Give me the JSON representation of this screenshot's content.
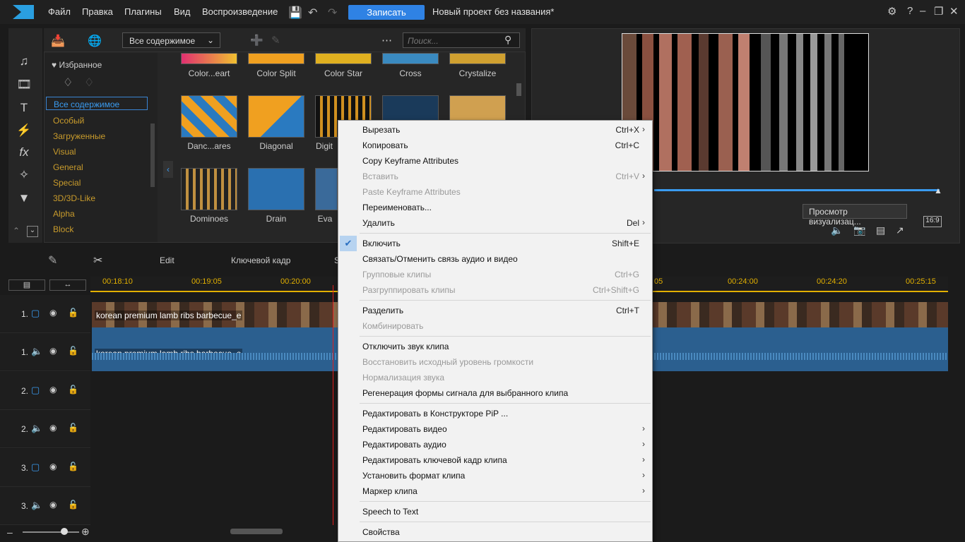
{
  "menubar": {
    "items": [
      "Файл",
      "Правка",
      "Плагины",
      "Вид",
      "Воспроизведение"
    ],
    "record": "Записать",
    "project_title": "Новый проект без названия*"
  },
  "library": {
    "dropdown": "Все содержимое",
    "search_placeholder": "Поиск...",
    "favorites": "Избранное",
    "all_content": "Все содержимое",
    "categories": [
      "Особый",
      "Загруженные",
      "Visual",
      "General",
      "Special",
      "3D/3D-Like",
      "Alpha",
      "Block"
    ],
    "thumbs_row1": [
      "Color...eart",
      "Color Split",
      "Color Star",
      "Cross",
      "Crystalize"
    ],
    "thumbs_row2": [
      "Danc...ares",
      "Diagonal",
      "Digit"
    ],
    "thumbs_row3": [
      "Dominoes",
      "Drain",
      "Eva"
    ]
  },
  "preview": {
    "render_button": "Просмотр визуализац...",
    "aspect": "16:9"
  },
  "timeline": {
    "tools": [
      "Edit",
      "Ключевой кадр",
      "S"
    ],
    "timecodes": [
      "00:18:10",
      "00:19:05",
      "00:20:00",
      "00:24:00",
      "00:24:20",
      "00:25:15",
      "05"
    ],
    "tracks": [
      "1.",
      "1.",
      "2.",
      "2.",
      "3.",
      "3."
    ],
    "clip_name": "korean premium lamb ribs barbecue_e"
  },
  "context_menu": [
    {
      "label": "Вырезать",
      "shortcut": "Ctrl+X",
      "arrow": true,
      "disabled": false
    },
    {
      "label": "Копировать",
      "shortcut": "Ctrl+C",
      "disabled": false
    },
    {
      "label": "Copy Keyframe Attributes",
      "disabled": false
    },
    {
      "label": "Вставить",
      "shortcut": "Ctrl+V",
      "arrow": true,
      "disabled": true
    },
    {
      "label": "Paste Keyframe Attributes",
      "disabled": true
    },
    {
      "label": "Переименовать...",
      "disabled": false
    },
    {
      "label": "Удалить",
      "shortcut": "Del",
      "arrow": true,
      "disabled": false
    },
    {
      "sep": true
    },
    {
      "label": "Включить",
      "shortcut": "Shift+E",
      "checked": true,
      "disabled": false
    },
    {
      "label": "Связать/Отменить связь аудио и видео",
      "disabled": false
    },
    {
      "label": "Групповые клипы",
      "shortcut": "Ctrl+G",
      "disabled": true
    },
    {
      "label": "Разгруппировать клипы",
      "shortcut": "Ctrl+Shift+G",
      "disabled": true
    },
    {
      "sep": true
    },
    {
      "label": "Разделить",
      "shortcut": "Ctrl+T",
      "disabled": false
    },
    {
      "label": "Комбинировать",
      "disabled": true
    },
    {
      "sep": true
    },
    {
      "label": "Отключить звук клипа",
      "disabled": false
    },
    {
      "label": "Восстановить исходный уровень громкости",
      "disabled": true
    },
    {
      "label": "Нормализация звука",
      "disabled": true
    },
    {
      "label": "Регенерация формы сигнала для выбранного клипа",
      "disabled": false
    },
    {
      "sep": true
    },
    {
      "label": "Редактировать в Конструкторе PiP ...",
      "disabled": false
    },
    {
      "label": "Редактировать видео",
      "arrow": true,
      "disabled": false
    },
    {
      "label": "Редактировать аудио",
      "arrow": true,
      "disabled": false
    },
    {
      "label": "Редактировать ключевой кадр клипа",
      "arrow": true,
      "disabled": false
    },
    {
      "label": "Установить формат клипа",
      "arrow": true,
      "disabled": false
    },
    {
      "label": "Маркер клипа",
      "arrow": true,
      "disabled": false
    },
    {
      "sep": true
    },
    {
      "label": "Speech to Text",
      "disabled": false
    },
    {
      "sep": true
    },
    {
      "label": "Свойства",
      "disabled": false
    }
  ],
  "colors": {
    "accent": "#2f82e4",
    "category": "#c89b2c",
    "timecode": "#e2b000",
    "playhead": "#e02020"
  }
}
